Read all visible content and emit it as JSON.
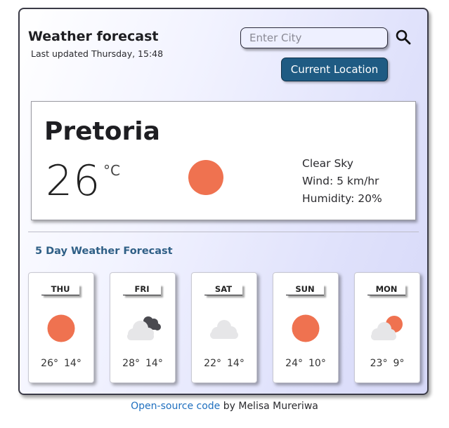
{
  "header": {
    "title": "Weather forecast",
    "last_updated": "Last updated Thursday, 15:48"
  },
  "search": {
    "placeholder": "Enter City",
    "icon": "search-icon"
  },
  "location_button": {
    "label": "Current Location"
  },
  "current": {
    "city": "Pretoria",
    "temperature": "26",
    "unit": "°C",
    "icon": "sun-icon",
    "condition": "Clear Sky",
    "wind": "Wind: 5 km/hr",
    "humidity": "Humidity: 20%"
  },
  "forecast": {
    "title": "5 Day Weather Forecast",
    "days": [
      {
        "day": "THU",
        "icon": "sun-icon",
        "max": "26°",
        "min": "14°"
      },
      {
        "day": "FRI",
        "icon": "cloud-dark-cloud-icon",
        "max": "28°",
        "min": "14°"
      },
      {
        "day": "SAT",
        "icon": "cloud-icon",
        "max": "22°",
        "min": "14°"
      },
      {
        "day": "SUN",
        "icon": "sun-icon",
        "max": "24°",
        "min": "10°"
      },
      {
        "day": "MON",
        "icon": "sun-behind-cloud-icon",
        "max": "23°",
        "min": "9°"
      }
    ]
  },
  "footer": {
    "link_text": "Open-source code",
    "by_text": " by Melisa Mureriwa"
  },
  "colors": {
    "sun": "#ef7250",
    "button": "#1f5b83",
    "forecast_title": "#2f5f86",
    "link": "#1f6fbf"
  }
}
